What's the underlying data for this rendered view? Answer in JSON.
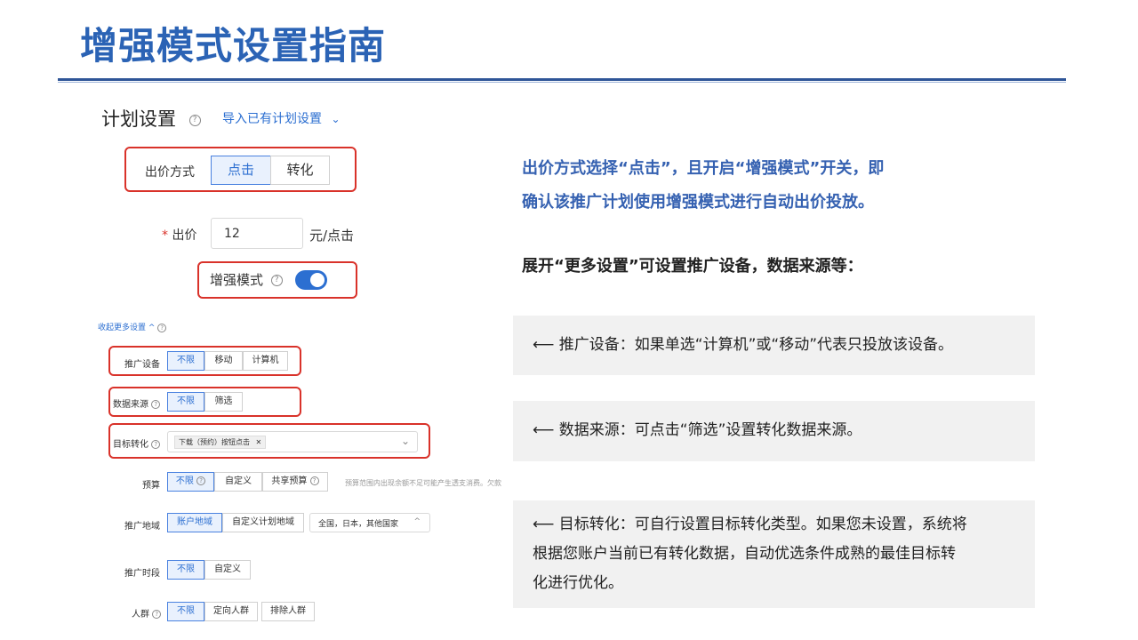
{
  "slide": {
    "title": "增强模式设置指南"
  },
  "plan": {
    "title": "计划设置",
    "import_link": "导入已有计划设置",
    "bid_method_label": "出价方式",
    "bid_methods": [
      "点击",
      "转化"
    ],
    "bid_label": "出价",
    "bid_required_mark": "*",
    "bid_value": "12",
    "bid_unit": "元/点击",
    "enhanced_mode_label": "增强模式",
    "enhanced_mode_on": true,
    "collapse_link": "收起更多设置 ^",
    "device_label": "推广设备",
    "device_options": [
      "不限",
      "移动",
      "计算机"
    ],
    "source_label": "数据来源",
    "source_options": [
      "不限",
      "筛选"
    ],
    "target_label": "目标转化",
    "target_tag": "下载（预约）按钮点击",
    "budget_label": "预算",
    "budget_options": [
      "不限",
      "自定义",
      "共享预算"
    ],
    "budget_hint": "预算范围内出现余额不足可能产生透支消费。欠款",
    "region_label": "推广地域",
    "region_options": [
      "账户地域",
      "自定义计划地域"
    ],
    "region_value": "全国，日本，其他国家",
    "time_label": "推广时段",
    "time_options": [
      "不限",
      "自定义"
    ],
    "crowd_label": "人群",
    "crowd_options": [
      "不限",
      "定向人群",
      "排除人群"
    ]
  },
  "notes": {
    "intro_line1": "出价方式选择“点击”，且开启“增强模式”开关，即",
    "intro_line2": "确认该推广计划使用增强模式进行自动出价投放。",
    "more_settings": "展开“更多设置”可设置推广设备，数据来源等：",
    "device_note": "⟵  推广设备：如果单选“计算机”或“移动”代表只投放该设备。",
    "source_note": "⟵  数据来源：可点击“筛选”设置转化数据来源。",
    "target_note_line1": "⟵  目标转化：可自行设置目标转化类型。如果您未设置，系统将",
    "target_note_line2": "根据您账户当前已有转化数据，自动优选条件成熟的最佳目标转",
    "target_note_line3": "化进行优化。"
  },
  "colors": {
    "title": "#2b63b5",
    "accent": "#2c6fd1",
    "highlight": "#d9322a",
    "note_bg": "#f1f1f1"
  }
}
